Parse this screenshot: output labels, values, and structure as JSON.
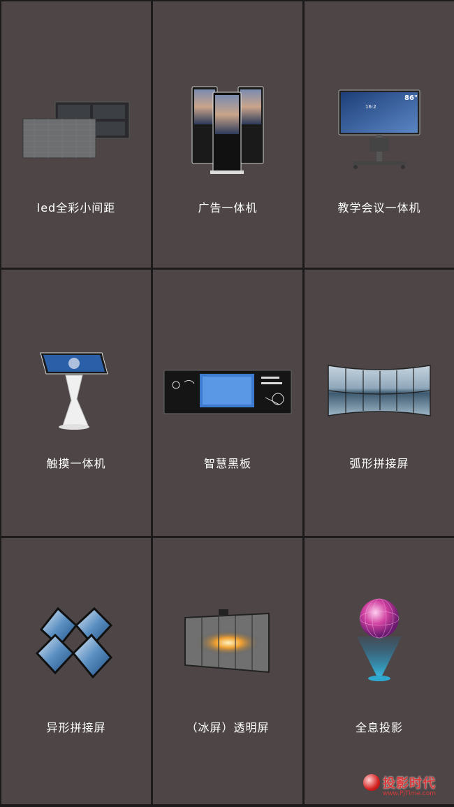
{
  "products": [
    {
      "label": "led全彩小间距",
      "icon": "led-panel-icon"
    },
    {
      "label": "广告一体机",
      "icon": "ad-kiosk-icon"
    },
    {
      "label": "教学会议一体机",
      "icon": "conference-display-icon"
    },
    {
      "label": "触摸一体机",
      "icon": "touch-kiosk-icon"
    },
    {
      "label": "智慧黑板",
      "icon": "smart-blackboard-icon"
    },
    {
      "label": "弧形拼接屏",
      "icon": "curved-video-wall-icon"
    },
    {
      "label": "异形拼接屏",
      "icon": "shaped-video-wall-icon"
    },
    {
      "label": "（冰屏）透明屏",
      "icon": "transparent-screen-icon"
    },
    {
      "label": "全息投影",
      "icon": "hologram-projection-icon"
    }
  ],
  "watermark": {
    "brand": "投影时代",
    "url": "www.PjTime.com"
  },
  "colors": {
    "tile_bg": "#4e4646",
    "grid_line": "#1c1a1a",
    "label_text": "#ffffff",
    "watermark": "#d63a3a"
  }
}
